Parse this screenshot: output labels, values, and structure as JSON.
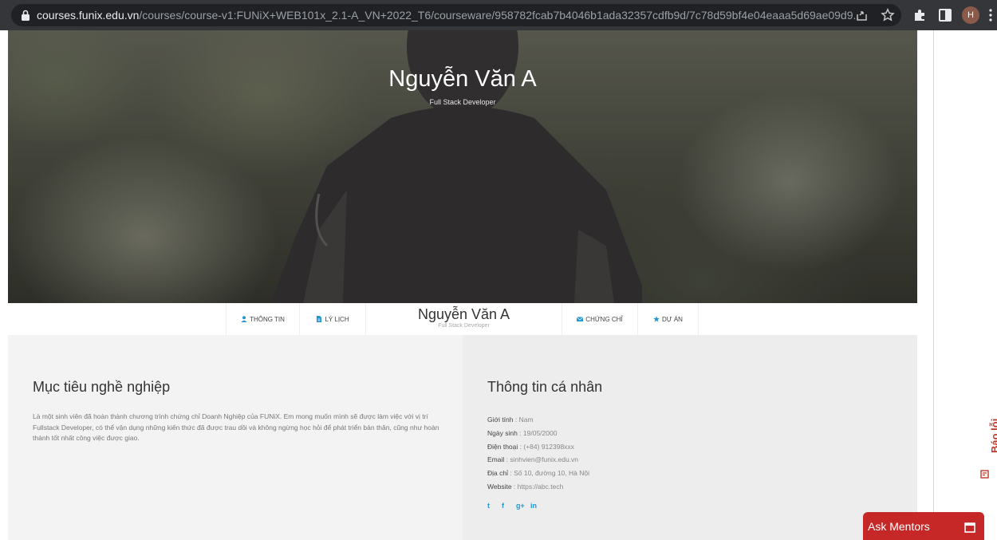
{
  "browser": {
    "url_host": "courses.funix.edu.vn",
    "url_path": "/courses/course-v1:FUNiX+WEB101x_2.1-A_VN+2022_T6/courseware/958782fcab7b4046b1ada32357cdfb9d/7c78d59bf4e04eaaa5d69ae09d9...",
    "profile_initial": "H"
  },
  "hero": {
    "name": "Nguyễn Văn A",
    "role": "Full Stack Developer"
  },
  "nav": {
    "items": [
      {
        "label": "THÔNG TIN",
        "icon": "user-icon"
      },
      {
        "label": "LÝ LỊCH",
        "icon": "document-icon"
      },
      {
        "label": "CHỨNG CHỈ",
        "icon": "envelope-icon"
      },
      {
        "label": "DỰ ÁN",
        "icon": "star-icon"
      }
    ],
    "brand_name": "Nguyễn Văn A",
    "brand_role": "Full Stack Developer"
  },
  "objective": {
    "title": "Mục tiêu nghề nghiệp",
    "text": "Là một sinh viên đã hoàn thành chương trình chứng chỉ Doanh Nghiệp của FUNiX. Em mong muốn mình sẽ được làm việc với vị trí Fullstack Developer, có thể vận dụng những kiến thức đã được trau dồi và không ngừng học hỏi để phát triển bản thân, cũng như hoàn thành tốt nhất công việc được giao."
  },
  "personal": {
    "title": "Thông tin cá nhân",
    "rows": [
      {
        "key": "Giới tính",
        "value": "Nam"
      },
      {
        "key": "Ngày sinh",
        "value": "19/05/2000"
      },
      {
        "key": "Điện thoại",
        "value": "(+84) 912398xxx"
      },
      {
        "key": "Email",
        "value": "sinhvien@funix.edu.vn"
      },
      {
        "key": "Địa chỉ",
        "value": "Số 10, đường 10, Hà Nội"
      },
      {
        "key": "Website",
        "value": "https://abc.tech"
      }
    ],
    "socials": [
      "twitter-icon",
      "facebook-icon",
      "google-plus-icon",
      "linkedin-icon"
    ],
    "social_glyphs": [
      "t",
      "f",
      "g+",
      "in"
    ]
  },
  "widgets": {
    "report_label": "Báo lỗi",
    "ask_mentors_label": "Ask Mentors"
  },
  "colors": {
    "accent_blue": "#2196d3",
    "ask_mentors_red": "#c62828",
    "report_red": "#c0392b"
  }
}
